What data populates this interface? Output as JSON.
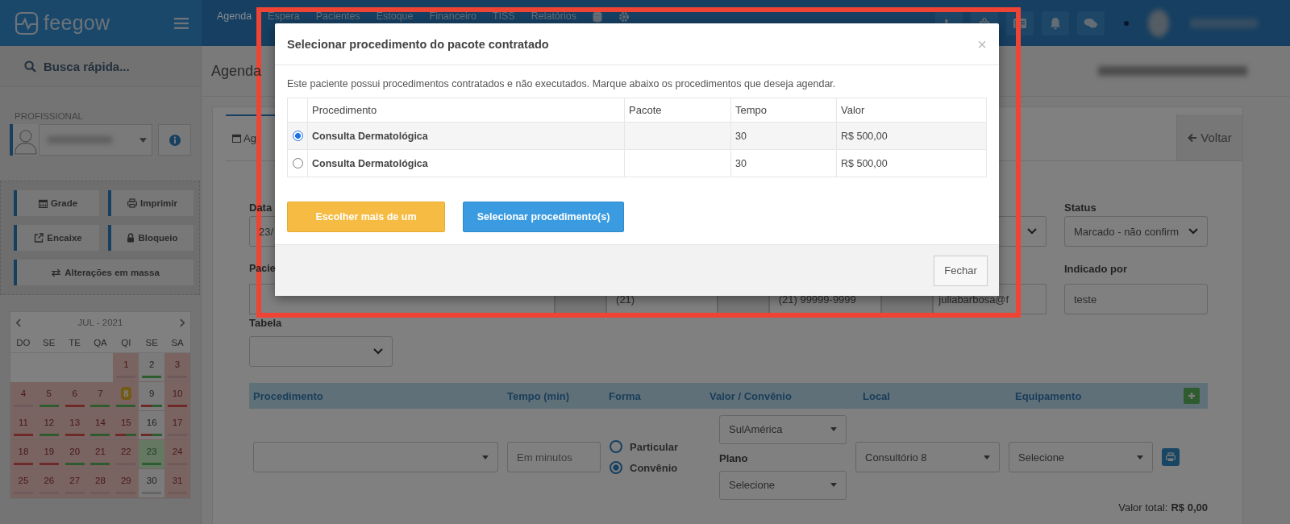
{
  "navbar": {
    "logo": "feegow",
    "menu": [
      {
        "label": "Agenda",
        "selected": true
      },
      {
        "label": "Espera",
        "selected": false
      },
      {
        "label": "Pacientes",
        "selected": false
      },
      {
        "label": "Estoque",
        "selected": false
      },
      {
        "label": "Financeiro",
        "selected": false
      },
      {
        "label": "TISS",
        "selected": false
      },
      {
        "label": "Relatórios",
        "selected": false
      }
    ]
  },
  "sidebar": {
    "search": {
      "placeholder": "Busca rápida..."
    },
    "professional_label": "PROFISSIONAL",
    "actions": [
      {
        "label": "Grade"
      },
      {
        "label": "Imprimir"
      },
      {
        "label": "Encaixe"
      },
      {
        "label": "Bloqueio"
      },
      {
        "label": "Alterações em massa"
      }
    ],
    "calendar": {
      "title": "JUL - 2021",
      "weekdays": [
        "DO",
        "SE",
        "TE",
        "QA",
        "QI",
        "SE",
        "SA"
      ],
      "weeks": [
        [
          {
            "day": "1",
            "kind": "closed",
            "selected": false,
            "today": false,
            "marks": [
              {
                "color": "#6e5a5a"
              }
            ]
          },
          {
            "day": "2",
            "kind": "open",
            "selected": false,
            "today": false,
            "marks": [
              {
                "color": "#2e5c2e"
              }
            ]
          },
          {
            "day": "3",
            "kind": "closed",
            "selected": false,
            "today": false,
            "marks": [
              {
                "color": "#6e5a5a"
              }
            ]
          }
        ],
        [
          {
            "day": "4",
            "kind": "closed",
            "selected": false,
            "today": false,
            "marks": [
              {
                "color": "#6e5a5a"
              }
            ]
          },
          {
            "day": "5",
            "kind": "closed",
            "selected": false,
            "today": false,
            "marks": [
              {
                "color": "#2e5c2e"
              }
            ]
          },
          {
            "day": "6",
            "kind": "closed",
            "selected": false,
            "today": false,
            "marks": [
              {
                "color": "#6d2a28"
              }
            ]
          },
          {
            "day": "7",
            "kind": "closed",
            "selected": false,
            "today": false,
            "marks": [
              {
                "color": "#2e5c2e"
              }
            ]
          },
          {
            "day": "8",
            "kind": "closed",
            "selected": false,
            "today": true,
            "marks": [
              {
                "color": "#2e5c2e"
              }
            ]
          },
          {
            "day": "9",
            "kind": "open",
            "selected": false,
            "today": false,
            "marks": [
              {
                "color": "#6d2a28"
              },
              {
                "color": "#2e5c2e"
              }
            ]
          },
          {
            "day": "10",
            "kind": "closed",
            "selected": false,
            "today": false,
            "marks": [
              {
                "color": "#6d2a28"
              }
            ]
          }
        ],
        [
          {
            "day": "11",
            "kind": "closed",
            "selected": false,
            "today": false,
            "marks": [
              {
                "color": "#6d2a28"
              }
            ]
          },
          {
            "day": "12",
            "kind": "closed",
            "selected": false,
            "today": false,
            "marks": [
              {
                "color": "#2e5c2e"
              }
            ]
          },
          {
            "day": "13",
            "kind": "closed",
            "selected": false,
            "today": false,
            "marks": [
              {
                "color": "#6d2a28"
              }
            ]
          },
          {
            "day": "14",
            "kind": "closed",
            "selected": false,
            "today": false,
            "marks": [
              {
                "color": "#2e5c2e"
              }
            ]
          },
          {
            "day": "15",
            "kind": "closed",
            "selected": false,
            "today": false,
            "marks": [
              {
                "color": "#6d2a28"
              },
              {
                "color": "#2e5c2e"
              }
            ]
          },
          {
            "day": "16",
            "kind": "open",
            "selected": false,
            "today": false,
            "marks": [
              {
                "color": "#6d2a28"
              },
              {
                "color": "#2e5c2e"
              }
            ]
          },
          {
            "day": "17",
            "kind": "closed",
            "selected": false,
            "today": false,
            "marks": [
              {
                "color": "#6e5a5a"
              }
            ]
          }
        ],
        [
          {
            "day": "18",
            "kind": "closed",
            "selected": false,
            "today": false,
            "marks": [
              {
                "color": "#6d2a28"
              }
            ]
          },
          {
            "day": "19",
            "kind": "closed",
            "selected": false,
            "today": false,
            "marks": [
              {
                "color": "#6d2a28"
              }
            ]
          },
          {
            "day": "20",
            "kind": "closed",
            "selected": false,
            "today": false,
            "marks": [
              {
                "color": "#2e5c2e"
              }
            ]
          },
          {
            "day": "21",
            "kind": "closed",
            "selected": false,
            "today": false,
            "marks": [
              {
                "color": "#2e5c2e"
              }
            ]
          },
          {
            "day": "22",
            "kind": "closed",
            "selected": false,
            "today": false,
            "marks": [
              {
                "color": "#6e5a5a"
              }
            ]
          },
          {
            "day": "23",
            "kind": "open",
            "selected": true,
            "today": false,
            "marks": [
              {
                "color": "#2e5c2e"
              }
            ]
          },
          {
            "day": "24",
            "kind": "closed",
            "selected": false,
            "today": false,
            "marks": [
              {
                "color": "#6e5a5a"
              }
            ]
          }
        ],
        [
          {
            "day": "25",
            "kind": "closed",
            "selected": false,
            "today": false,
            "marks": [
              {
                "color": "#6e5a5a"
              }
            ]
          },
          {
            "day": "26",
            "kind": "closed",
            "selected": false,
            "today": false,
            "marks": [
              {
                "color": "#6e5a5a"
              }
            ]
          },
          {
            "day": "27",
            "kind": "closed",
            "selected": false,
            "today": false,
            "marks": [
              {
                "color": "#6e5a5a"
              }
            ]
          },
          {
            "day": "28",
            "kind": "closed",
            "selected": false,
            "today": false,
            "marks": [
              {
                "color": "#6e5a5a"
              }
            ]
          },
          {
            "day": "29",
            "kind": "closed",
            "selected": false,
            "today": false,
            "marks": [
              {
                "color": "#6e5a5a"
              }
            ]
          },
          {
            "day": "30",
            "kind": "open",
            "selected": false,
            "today": false,
            "marks": [
              {
                "color": "#666666"
              }
            ]
          },
          {
            "day": "31",
            "kind": "closed",
            "selected": false,
            "today": false,
            "marks": [
              {
                "color": "#6e5a5a"
              }
            ]
          }
        ]
      ]
    }
  },
  "page": {
    "title": "Agenda",
    "tab": {
      "label": "Ag"
    },
    "back_button": "Voltar",
    "form": {
      "date_label": "Data",
      "date_value": "23/",
      "status_label": "Status",
      "status_value": "Marcado - não confirm",
      "patient_label": "Pacie",
      "phone_value": "(21)",
      "mobile_value": "(21) 99999-9999",
      "email_value": "juliabarbosa@f",
      "referral_label": "Indicado por",
      "referral_value": "teste",
      "table_label": "Tabela"
    },
    "procedures": {
      "columns": [
        "Procedimento",
        "Tempo (min)",
        "Forma",
        "Valor / Convênio",
        "Local",
        "Equipamento"
      ],
      "minutes": {
        "placeholder": "Em minutos"
      },
      "payment": [
        {
          "label": "Particular",
          "selected": false
        },
        {
          "label": "Convênio",
          "selected": true
        }
      ],
      "insurance": "SulAmérica",
      "plan_label": "Plano",
      "plan_value": "Selecione",
      "location": "Consultório 8",
      "equipment": "Selecione"
    },
    "total_label": "Valor total:",
    "total_value": "R$ 0,00"
  },
  "modal": {
    "title": "Selecionar procedimento do pacote contratado",
    "close": "×",
    "intro": "Este paciente possui procedimentos contratados e não executados. Marque abaixo os procedimentos que deseja agendar.",
    "columns": [
      "Procedimento",
      "Pacote",
      "Tempo",
      "Valor"
    ],
    "rows": [
      {
        "procedure": "Consulta Dermatológica",
        "time": "30",
        "value": "R$ 500,00",
        "selected": true
      },
      {
        "procedure": "Consulta Dermatológica",
        "time": "30",
        "value": "R$ 500,00",
        "selected": false
      }
    ],
    "buttons": [
      "Escolher mais de um",
      "Selecionar procedimento(s)"
    ],
    "close_button": "Fechar"
  }
}
